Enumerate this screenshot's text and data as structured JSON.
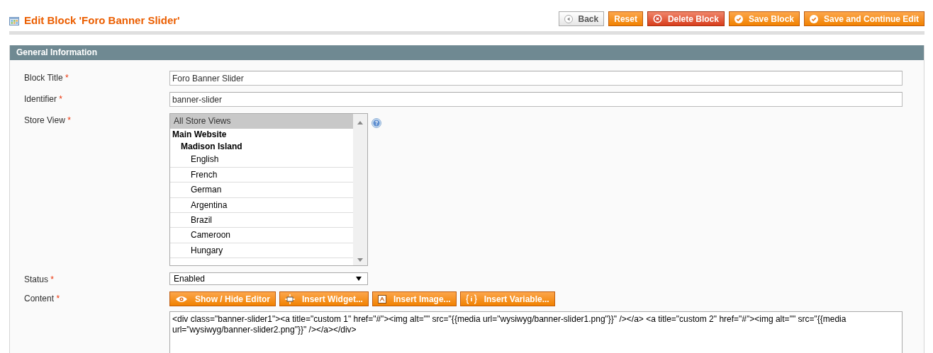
{
  "header": {
    "title": "Edit Block 'Foro Banner Slider'"
  },
  "buttons": [
    {
      "label": "Back",
      "kind": "back"
    },
    {
      "label": "Reset",
      "kind": "plain"
    },
    {
      "label": "Delete Block",
      "kind": "delete"
    },
    {
      "label": "Save Block",
      "kind": "save"
    },
    {
      "label": "Save and Continue Edit",
      "kind": "save"
    }
  ],
  "section": {
    "title": "General Information"
  },
  "fields": [
    {
      "label": "Block Title",
      "required_mark": "*",
      "kind": "text",
      "value": "Foro Banner Slider"
    },
    {
      "label": "Identifier",
      "required_mark": "*",
      "kind": "text",
      "value": "banner-slider"
    },
    {
      "label": "Store View",
      "required_mark": "*",
      "kind": "multiselect",
      "options": [
        {
          "label": "All Store Views",
          "kind": "option",
          "selected": true
        },
        {
          "label": "Main Website",
          "kind": "group",
          "selected": false,
          "children": [
            {
              "label": "Madison Island",
              "kind": "group",
              "selected": false,
              "children": [
                {
                  "label": "English",
                  "kind": "option",
                  "selected": false
                },
                {
                  "label": "French",
                  "kind": "option",
                  "selected": false
                },
                {
                  "label": "German",
                  "kind": "option",
                  "selected": false
                },
                {
                  "label": "Argentina",
                  "kind": "option",
                  "selected": false
                },
                {
                  "label": "Brazil",
                  "kind": "option",
                  "selected": false
                },
                {
                  "label": "Cameroon",
                  "kind": "option",
                  "selected": false
                },
                {
                  "label": "Hungary",
                  "kind": "option",
                  "selected": false
                }
              ]
            }
          ]
        }
      ]
    },
    {
      "label": "Status",
      "required_mark": "*",
      "kind": "select",
      "value": "Enabled"
    },
    {
      "label": "Content",
      "required_mark": "*",
      "kind": "editor",
      "tools": [
        {
          "label": "Show / Hide Editor",
          "kind": "toggle"
        },
        {
          "label": "Insert Widget...",
          "kind": "widget"
        },
        {
          "label": "Insert Image...",
          "kind": "image"
        },
        {
          "label": "Insert Variable...",
          "kind": "variable"
        }
      ],
      "value": "<div class=\"banner-slider1\"><a title=\"custom 1\" href=\"#\"><img alt=\"\" src=\"{{media url=\"wysiwyg/banner-slider1.png\"}}\" /></a> <a title=\"custom 2\" href=\"#\"><img alt=\"\" src=\"{{media url=\"wysiwyg/banner-slider2.png\"}}\" /></a></div>"
    }
  ]
}
